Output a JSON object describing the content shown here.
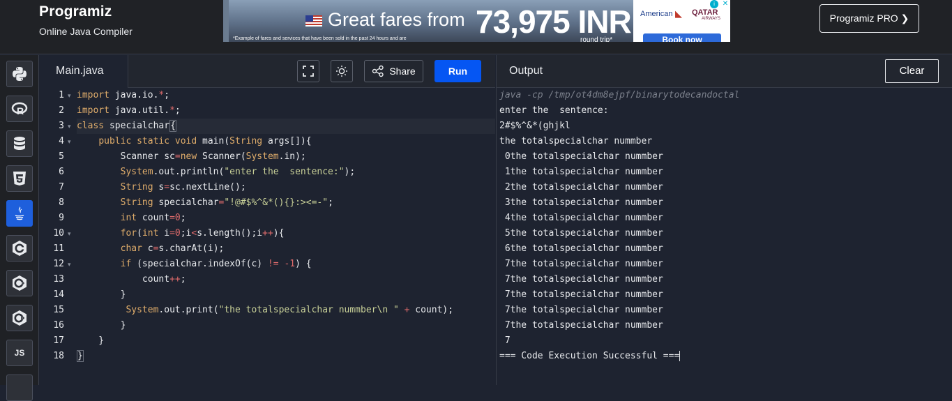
{
  "header": {
    "logo": "Programiz",
    "subtitle": "Online Java Compiler",
    "pro_button": "Programiz PRO ❯"
  },
  "ad": {
    "headline": "Great fares from",
    "price": "73,975 INR",
    "fine_print": "*Example of fares and services that have been sold in the past 24 hours and are",
    "round_trip": "round trip*",
    "airline1": "American",
    "airline2": "QATAR",
    "airline2_sub": "AIRWAYS",
    "cta": "Book now"
  },
  "sidebar": {
    "languages": [
      "python",
      "r",
      "sql",
      "html",
      "java",
      "c",
      "cpp",
      "csharp",
      "javascript"
    ],
    "js_label": "JS"
  },
  "editor": {
    "tab": "Main.java",
    "share_label": "Share",
    "run_label": "Run",
    "line_numbers": [
      "1",
      "2",
      "3",
      "4",
      "5",
      "6",
      "7",
      "8",
      "9",
      "10",
      "11",
      "12",
      "13",
      "14",
      "15",
      "16",
      "17",
      "18"
    ]
  },
  "output": {
    "title": "Output",
    "clear_label": "Clear",
    "lines": [
      "java -cp /tmp/ot4dm8ejpf/binarytodecandoctal",
      "enter the  sentence:",
      "2#$%^&*(ghjkl",
      "the totalspecialchar nummber",
      " 0the totalspecialchar nummber",
      " 1the totalspecialchar nummber",
      " 2the totalspecialchar nummber",
      " 3the totalspecialchar nummber",
      " 4the totalspecialchar nummber",
      " 5the totalspecialchar nummber",
      " 6the totalspecialchar nummber",
      " 7the totalspecialchar nummber",
      " 7the totalspecialchar nummber",
      " 7the totalspecialchar nummber",
      " 7the totalspecialchar nummber",
      " 7the totalspecialchar nummber",
      " 7",
      "=== Code Execution Successful ==="
    ]
  },
  "colors": {
    "run_blue": "#0556f3",
    "active_lang": "#1e5fdc",
    "keyword": "#e0ad6b",
    "string": "#c9d198",
    "number": "#e26c6c"
  }
}
